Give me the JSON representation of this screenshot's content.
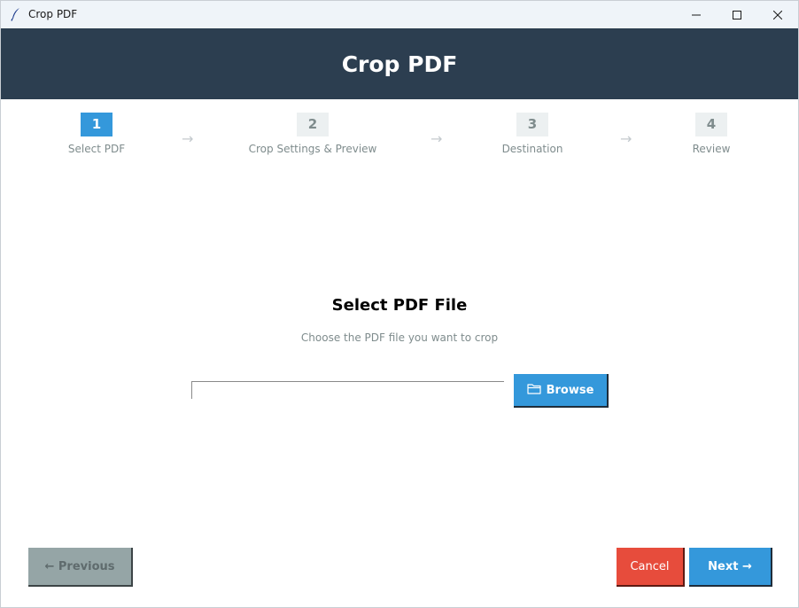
{
  "window": {
    "title": "Crop PDF",
    "app_icon": "feather-icon",
    "controls": [
      "minimize-icon",
      "maximize-icon",
      "close-icon"
    ]
  },
  "header": {
    "title": "Crop PDF"
  },
  "steps": [
    {
      "number": "1",
      "label": "Select PDF",
      "active": true
    },
    {
      "number": "2",
      "label": "Crop Settings & Preview",
      "active": false
    },
    {
      "number": "3",
      "label": "Destination",
      "active": false
    },
    {
      "number": "4",
      "label": "Review",
      "active": false
    }
  ],
  "step_arrow": "→",
  "content": {
    "title": "Select PDF File",
    "subtitle": "Choose the PDF file you want to crop",
    "file_path_value": "",
    "browse_label": "Browse",
    "browse_icon": "folder-icon"
  },
  "footer": {
    "previous_label": "← Previous",
    "cancel_label": "Cancel",
    "next_label": "Next →"
  },
  "colors": {
    "header_bg": "#2c3e50",
    "accent": "#3498db",
    "danger": "#e74c3c",
    "disabled": "#95a5a6",
    "muted_text": "#7f8c8d"
  }
}
